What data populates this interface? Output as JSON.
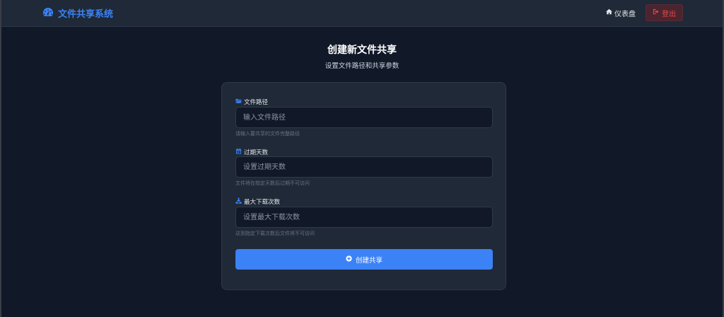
{
  "app": {
    "brand": "文件共享系统"
  },
  "nav": {
    "dashboard_label": "仪表盘",
    "logout_label": "登出"
  },
  "header": {
    "title": "创建新文件共享",
    "subtitle": "设置文件路径和共享参数"
  },
  "form": {
    "fields": [
      {
        "label": "文件路径",
        "placeholder": "输入文件路径",
        "value": "",
        "hint": "请输入要共享的文件完整路径",
        "icon": "folder-open-icon"
      },
      {
        "label": "过期天数",
        "placeholder": "设置过期天数",
        "value": "",
        "hint": "文件将在指定天数后过期不可访问",
        "icon": "calendar-icon"
      },
      {
        "label": "最大下载次数",
        "placeholder": "设置最大下载次数",
        "value": "",
        "hint": "达到指定下载次数后文件将不可访问",
        "icon": "download-icon"
      }
    ],
    "submit_label": "创建共享"
  },
  "colors": {
    "accent": "#3b82f6",
    "background": "#111827",
    "card": "#1f2937",
    "danger": "#ef4444"
  }
}
